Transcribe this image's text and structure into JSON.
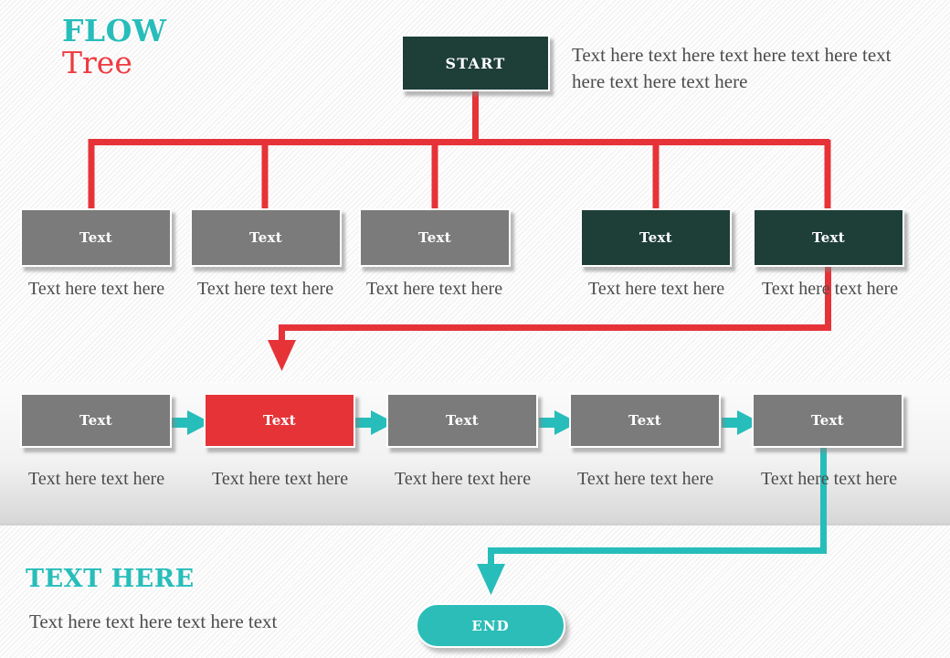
{
  "title": {
    "line1": "FLOW",
    "line2": "Tree"
  },
  "intro": {
    "text": "Text here text here text here text here text here text here text here"
  },
  "start": {
    "label": "START"
  },
  "tree_row": {
    "nodes": [
      {
        "label": "Text",
        "style": "gray",
        "caption": "Text here text here"
      },
      {
        "label": "Text",
        "style": "gray",
        "caption": "Text here text here"
      },
      {
        "label": "Text",
        "style": "gray",
        "caption": "Text here text here"
      },
      {
        "label": "Text",
        "style": "dark",
        "caption": "Text here text here"
      },
      {
        "label": "Text",
        "style": "dark",
        "caption": "Text here text here"
      }
    ]
  },
  "process_row": {
    "nodes": [
      {
        "label": "Text",
        "style": "gray",
        "caption": "Text here text here"
      },
      {
        "label": "Text",
        "style": "red",
        "caption": "Text here text here"
      },
      {
        "label": "Text",
        "style": "gray",
        "caption": "Text here text here"
      },
      {
        "label": "Text",
        "style": "gray",
        "caption": "Text here text here"
      },
      {
        "label": "Text",
        "style": "gray",
        "caption": "Text here text here"
      }
    ]
  },
  "bottom": {
    "heading": "TEXT HERE",
    "text": "Text here text here text here text"
  },
  "end": {
    "label": "END"
  },
  "colors": {
    "teal_accent": "#2cbdb8",
    "dark_teal": "#1e3e38",
    "red": "#e63338",
    "gray": "#7b7b7b",
    "text_gray": "#4c4c4c"
  }
}
